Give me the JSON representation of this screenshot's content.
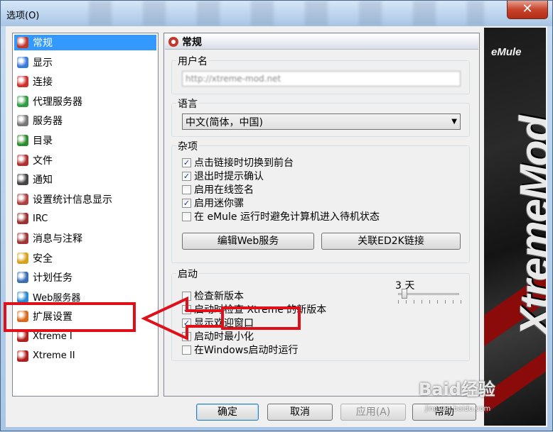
{
  "window": {
    "title": "选项(O)",
    "close_glyph": "✕"
  },
  "nav": {
    "items": [
      {
        "label": "常规",
        "icon": "general-icon",
        "color": "#c0392b",
        "selected": true
      },
      {
        "label": "显示",
        "icon": "display-icon",
        "color": "#3a7bd5"
      },
      {
        "label": "连接",
        "icon": "connection-icon",
        "color": "#d0312d"
      },
      {
        "label": "代理服务器",
        "icon": "proxy-icon",
        "color": "#2e9e3e"
      },
      {
        "label": "服务器",
        "icon": "server-icon",
        "color": "#777777"
      },
      {
        "label": "目录",
        "icon": "folder-icon",
        "color": "#2e8b2e"
      },
      {
        "label": "文件",
        "icon": "file-icon",
        "color": "#b03030"
      },
      {
        "label": "通知",
        "icon": "notification-icon",
        "color": "#444444"
      },
      {
        "label": "设置统计信息显示",
        "icon": "statistics-icon",
        "color": "#b04040"
      },
      {
        "label": "IRC",
        "icon": "irc-icon",
        "color": "#9a3030"
      },
      {
        "label": "消息与注释",
        "icon": "messages-icon",
        "color": "#a03535"
      },
      {
        "label": "安全",
        "icon": "security-icon",
        "color": "#d6a21d"
      },
      {
        "label": "计划任务",
        "icon": "scheduler-icon",
        "color": "#3a6fb5"
      },
      {
        "label": "Web服务器",
        "icon": "web-server-icon",
        "color": "#2a8ad0"
      },
      {
        "label": "扩展设置",
        "icon": "extended-settings-icon",
        "color": "#d86a1e"
      },
      {
        "label": "Xtreme I",
        "icon": "xtreme-icon",
        "color": "#b01e1e"
      },
      {
        "label": "Xtreme II",
        "icon": "xtreme-icon",
        "color": "#b01e1e"
      }
    ]
  },
  "panel": {
    "header": "常规",
    "username": {
      "label": "用户名",
      "value": "http://xtreme-mod.net"
    },
    "language": {
      "label": "语言",
      "selected": "中文(简体，中国)"
    },
    "misc": {
      "label": "杂项",
      "options": [
        {
          "label": "点击链接时切换到前台",
          "checked": true
        },
        {
          "label": "退出时提示确认",
          "checked": true
        },
        {
          "label": "启用在线签名",
          "checked": false
        },
        {
          "label": "启用迷你骡",
          "checked": true
        },
        {
          "label": "在 eMule 运行时避免计算机进入待机状态",
          "checked": false
        }
      ],
      "buttons": {
        "web": "编辑Web服务",
        "ed2k": "关联ED2K链接"
      }
    },
    "startup": {
      "label": "启动",
      "days": "3 天",
      "days_value": 3,
      "options": [
        {
          "label": "检查新版本",
          "checked": false
        },
        {
          "label": "启动时检查 Xtreme 的新版本",
          "checked": true
        },
        {
          "label": "显示欢迎窗口",
          "checked": true
        },
        {
          "label": "启动时最小化",
          "checked": false
        },
        {
          "label": "在Windows启动时运行",
          "checked": false
        }
      ]
    }
  },
  "buttons": {
    "ok": "确定",
    "cancel": "取消",
    "apply": "应用(A)",
    "help": "帮助"
  },
  "banner": {
    "logo": "eMule",
    "mod_text": "XtremeMod"
  },
  "watermark": {
    "text": "Baid经验",
    "sub": "jingyan.baidu.com"
  },
  "check_glyph": "✓",
  "annotation_color": "#e0101a"
}
